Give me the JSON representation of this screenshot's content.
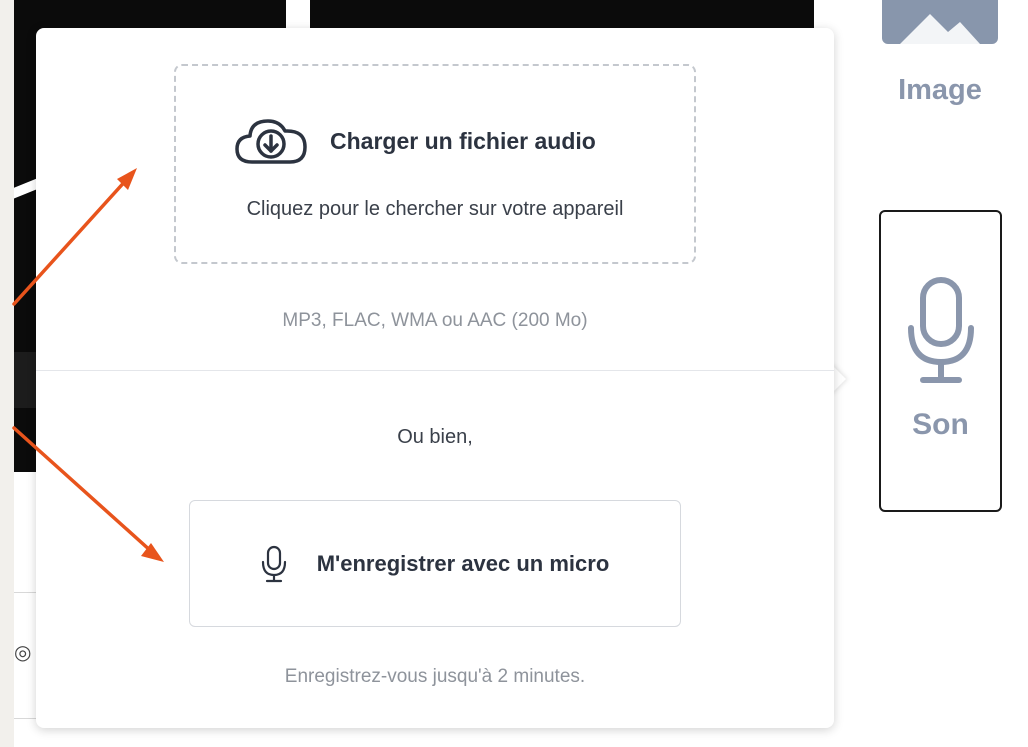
{
  "right_panel": {
    "image_label": "Image",
    "son_label": "Son"
  },
  "popup": {
    "upload_title": "Charger un fichier audio",
    "upload_subtitle": "Cliquez pour le chercher sur votre appareil",
    "formats": "MP3, FLAC, WMA ou AAC (200 Mo)",
    "or_text": "Ou bien,",
    "record_label": "M'enregistrer avec un micro",
    "record_hint": "Enregistrez-vous jusqu'à 2 minutes."
  },
  "icons": {
    "upload": "cloud-upload-icon",
    "record": "microphone-icon",
    "son": "microphone-icon"
  },
  "colors": {
    "annotation_arrow": "#e8541c",
    "muted_icon": "#8a96ac",
    "text_dark": "#2c3340",
    "text_muted": "#8e939b"
  }
}
